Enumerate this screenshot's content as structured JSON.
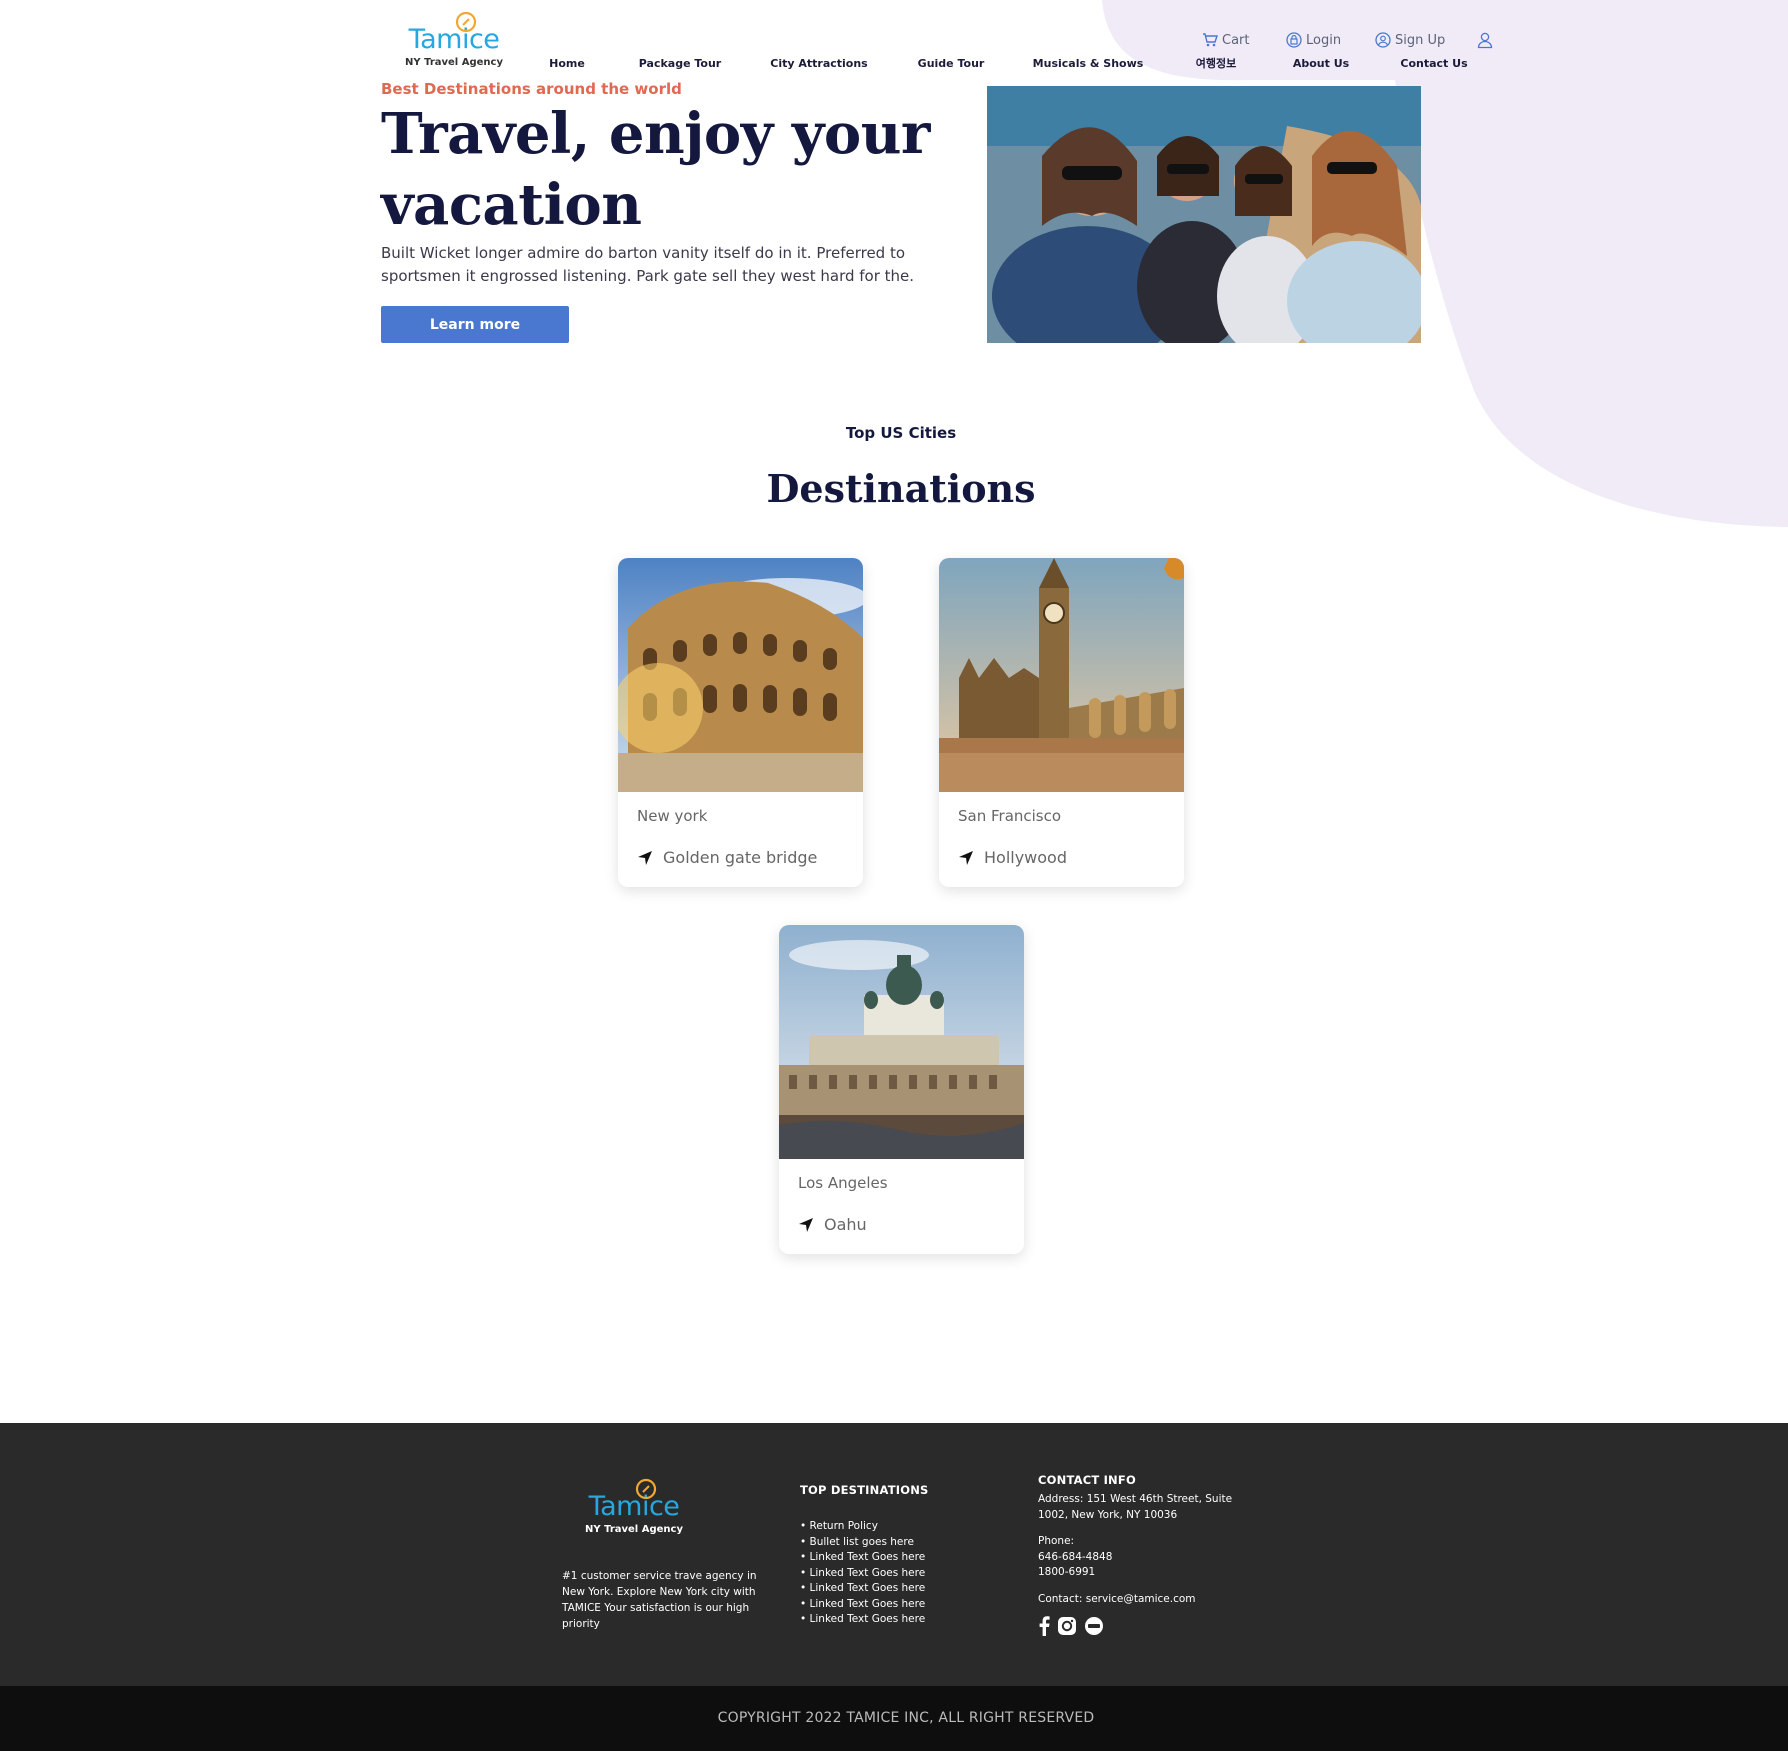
{
  "brand": {
    "name": "Tamice",
    "tagline": "NY Travel Agency",
    "color": "#25a8df",
    "accent": "#f0a830"
  },
  "nav": {
    "items": [
      "Home",
      "Package Tour",
      "City Attractions",
      "Guide Tour",
      "Musicals & Shows",
      "여행정보",
      "About Us",
      "Contact Us"
    ]
  },
  "utility": {
    "cart": "Cart",
    "login": "Login",
    "signup": "Sign Up"
  },
  "hero": {
    "eyebrow": "Best Destinations around the world",
    "title": "Travel, enjoy your vacation",
    "description": "Built Wicket longer admire do barton vanity itself do in it. Preferred to sportsmen it engrossed listening. Park gate sell they west hard for the.",
    "cta": "Learn more"
  },
  "destinations": {
    "subtitle": "Top US Cities",
    "title": "Destinations",
    "cards": [
      {
        "city": "New york",
        "location": "Golden gate bridge"
      },
      {
        "city": "San Francisco",
        "location": "Hollywood"
      },
      {
        "city": "Los Angeles",
        "location": "Oahu"
      }
    ]
  },
  "footer": {
    "about": "#1 customer service trave agency in New York. Explore New York city with TAMICE Your satisfaction is our high priority",
    "top_destinations": {
      "heading": "TOP DESTINATIONS",
      "links": [
        "• Return Policy",
        "• Bullet list goes here",
        "• Linked Text Goes here",
        "• Linked Text Goes here",
        "• Linked Text Goes here",
        "• Linked Text Goes here",
        "• Linked Text Goes here"
      ]
    },
    "contact": {
      "heading": "CONTACT INFO",
      "address": "Address: 151 West 46th Street, Suite 1002, New York, NY 10036",
      "phone_label": "Phone:",
      "phone1": "646-684-4848",
      "phone2": "1800-6991",
      "email": "Contact: service@tamice.com"
    },
    "social_icons": [
      "facebook-icon",
      "instagram-icon",
      "blog-icon"
    ]
  },
  "copyright": "COPYRIGHT 2022 TAMICE INC, ALL RIGHT RESERVED",
  "colors": {
    "heading": "#14183e",
    "eyebrow": "#df6951",
    "button": "#4a78d0",
    "blob": "#f1ebf8",
    "footer": "#2a2a2a"
  }
}
